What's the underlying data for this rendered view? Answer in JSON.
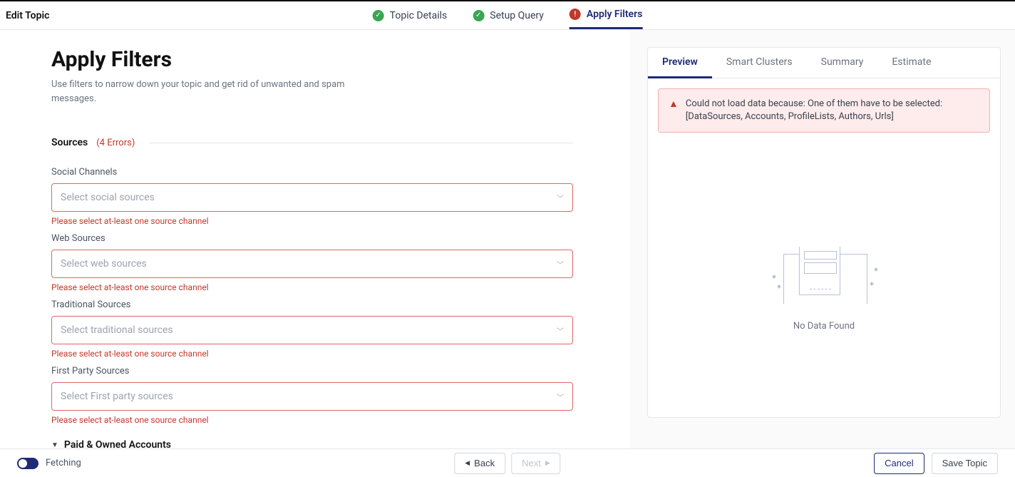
{
  "header": {
    "title": "Edit Topic",
    "steps": [
      {
        "label": "Topic Details",
        "status": "done"
      },
      {
        "label": "Setup Query",
        "status": "done"
      },
      {
        "label": "Apply Filters",
        "status": "error"
      }
    ]
  },
  "page": {
    "heading": "Apply Filters",
    "description": "Use filters to narrow down your topic and get rid of unwanted and spam messages."
  },
  "sources": {
    "section_label": "Sources",
    "error_count": "(4 Errors)",
    "fields": {
      "social": {
        "label": "Social Channels",
        "placeholder": "Select social sources",
        "error": "Please select at-least one source channel"
      },
      "web": {
        "label": "Web Sources",
        "placeholder": "Select web sources",
        "error": "Please select at-least one source channel"
      },
      "traditional": {
        "label": "Traditional Sources",
        "placeholder": "Select traditional sources",
        "error": "Please select at-least one source channel"
      },
      "firstparty": {
        "label": "First Party Sources",
        "placeholder": "Select First party sources",
        "error": "Please select at-least one source channel"
      }
    },
    "paid_section_label": "Paid & Owned Accounts"
  },
  "preview": {
    "tabs": {
      "preview": "Preview",
      "smart": "Smart Clusters",
      "summary": "Summary",
      "estimate": "Estimate"
    },
    "alert_text": "Could not load data because: One of them have to be selected: [DataSources, Accounts, ProfileLists, Authors, Urls]",
    "no_data": "No Data Found"
  },
  "footer": {
    "fetching": "Fetching",
    "back": "Back",
    "next": "Next",
    "cancel": "Cancel",
    "save": "Save Topic"
  }
}
